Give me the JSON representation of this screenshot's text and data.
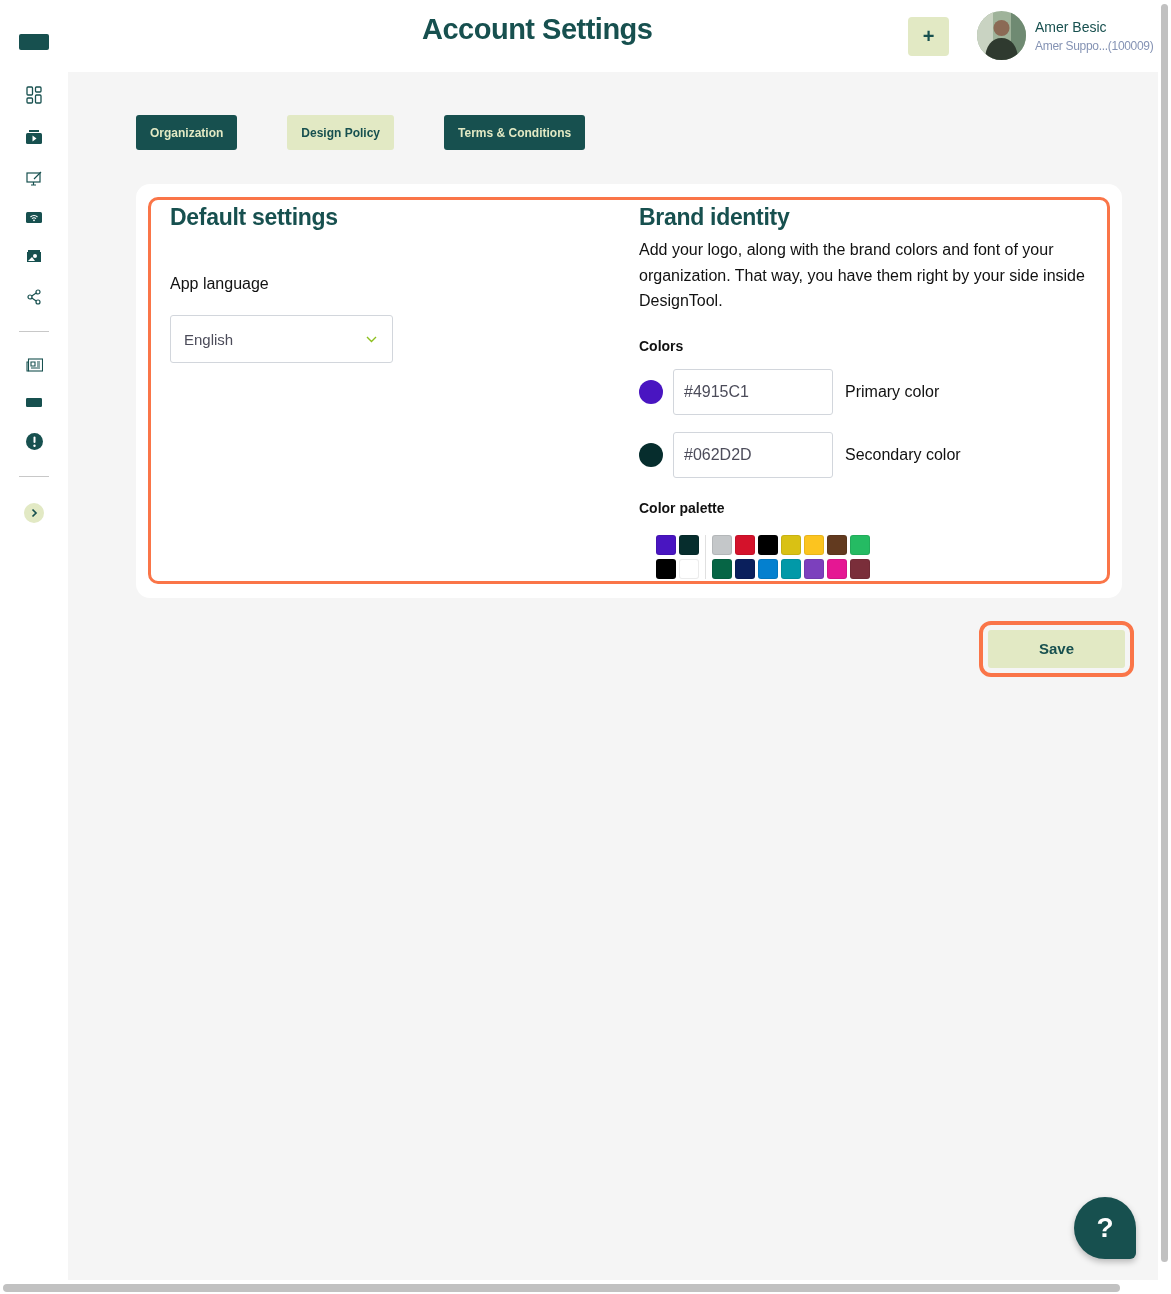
{
  "header": {
    "title": "Account Settings",
    "add_button": "+",
    "user": {
      "name": "Amer Besic",
      "subtitle": "Amer Suppo...(100009)"
    }
  },
  "tabs": [
    {
      "label": "Organization",
      "selected": false
    },
    {
      "label": "Design Policy",
      "selected": true
    },
    {
      "label": "Terms & Conditions",
      "selected": false
    }
  ],
  "default_settings": {
    "title": "Default settings",
    "language_label": "App language",
    "language_value": "English"
  },
  "brand_identity": {
    "title": "Brand identity",
    "description": "Add your logo, along with the brand colors and font of your organization. That way, you have them right by your side inside DesignTool.",
    "colors_label": "Colors",
    "colors": [
      {
        "value": "#4915C1",
        "label": "Primary color",
        "color": "#4915c1"
      },
      {
        "value": "#062D2D",
        "label": "Secondary color",
        "color": "#062d2d"
      }
    ],
    "palette_label": "Color palette",
    "palette_groups": [
      {
        "swatches": [
          {
            "color": "#4915c1"
          },
          {
            "color": "#062d2d"
          },
          {
            "color": "#000000"
          },
          {
            "color": "#ffffff"
          }
        ]
      },
      {
        "swatches": [
          {
            "color": "#c4c7c9"
          },
          {
            "color": "#d4122b"
          },
          {
            "color": "#000000"
          },
          {
            "color": "#d9c114"
          },
          {
            "color": "#fcc41f"
          },
          {
            "color": "#623a1f"
          },
          {
            "color": "#25bb63"
          },
          {
            "color": "#066545"
          },
          {
            "color": "#0a1f5c"
          },
          {
            "color": "#0480cf"
          },
          {
            "color": "#0299a8"
          },
          {
            "color": "#7c40bd"
          },
          {
            "color": "#e51793"
          },
          {
            "color": "#7a2e3a"
          }
        ]
      }
    ]
  },
  "save_button": "Save",
  "help_button": "?"
}
